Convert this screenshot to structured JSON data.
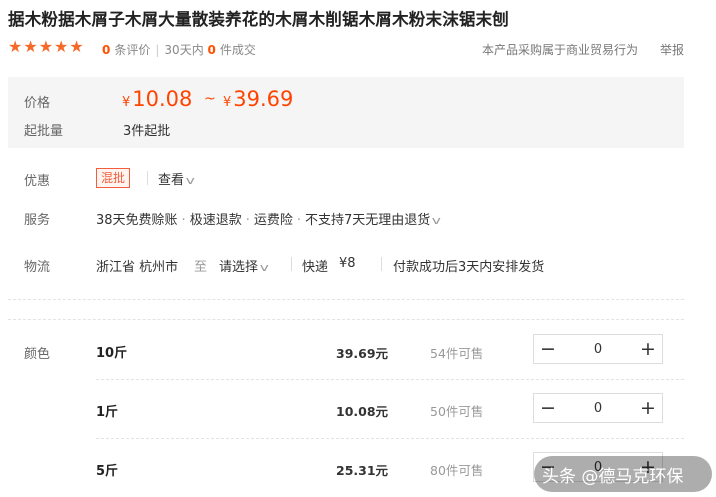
{
  "product": {
    "title": "据木粉据木屑子木屑大量散装养花的木屑木削锯木屑木粉末沫锯末刨"
  },
  "rating": {
    "stars": 5,
    "reviews_count": "0",
    "reviews_label": "条评价",
    "sold_period": "30天内",
    "sold_count": "0",
    "sold_label": "件成交",
    "policy": "本产品采购属于商业贸易行为",
    "report": "举报"
  },
  "price": {
    "label": "价格",
    "currency": "¥",
    "low": "10.08",
    "range_sep": "~",
    "high": "39.69",
    "moq_label": "起批量",
    "moq_value": "3件起批"
  },
  "promo": {
    "label": "优惠",
    "tag": "混批",
    "view": "查看"
  },
  "service": {
    "label": "服务",
    "items": [
      "38天免费赊账",
      "极速退款",
      "运费险",
      "不支持7天无理由退货"
    ]
  },
  "logistics": {
    "label": "物流",
    "origin": "浙江省 杭州市",
    "to": "至",
    "destination": "请选择",
    "method": "快递",
    "fee": "¥8",
    "ship_note": "付款成功后3天内安排发货"
  },
  "sku": {
    "label": "颜色",
    "rows": [
      {
        "name": "10斤",
        "price": "39.69元",
        "stock": "54件可售",
        "qty": "0"
      },
      {
        "name": "1斤",
        "price": "10.08元",
        "stock": "50件可售",
        "qty": "0"
      },
      {
        "name": "5斤",
        "price": "25.31元",
        "stock": "80件可售",
        "qty": "0"
      }
    ]
  },
  "watermark": "头条 @德马克环保",
  "colors": {
    "accent": "#ff4400",
    "star": "#f56a2a",
    "price_bg": "#f5f5f5"
  }
}
